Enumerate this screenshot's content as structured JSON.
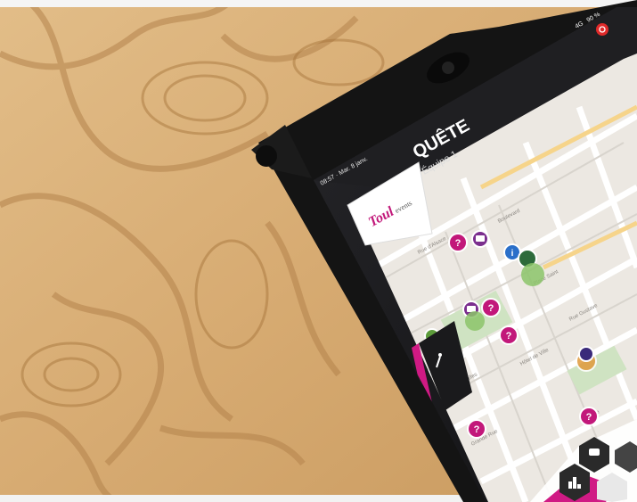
{
  "scene": {
    "description_tags": [
      "wooden-table",
      "tablet",
      "rugged-case",
      "map-app"
    ]
  },
  "tablet": {
    "status_bar": {
      "time_date": "08:57 · Mar. 8 janv.",
      "signal": "4G",
      "battery": "90 %"
    },
    "app": {
      "title": "QUÊTE",
      "subtitle": "Équipe 1",
      "logo_text": "Toul",
      "logo_subtext": "events"
    },
    "map": {
      "street_labels": [
        "Rue d'Alsace",
        "Boulevard",
        "Place Saint",
        "Rue des Halles",
        "Rue Gustave",
        "Hôtel de Ville",
        "Grande Rue",
        "Place"
      ]
    }
  },
  "colors": {
    "wood_base": "#d9b27c",
    "wood_grain": "#b07d44",
    "case": "#161616",
    "screen_bg": "#1e1e20",
    "map_bg": "#ece8e2",
    "accent_magenta": "#c2187a",
    "marker_purple": "#7b2f8e",
    "marker_green": "#5c9b3a",
    "marker_blue": "#2a6fc9",
    "marker_orange": "#e09a3c"
  },
  "icons": [
    "question-marker-icon",
    "info-marker-icon",
    "route-marker-icon",
    "chat-icon",
    "podium-icon",
    "power-icon",
    "signal-icon",
    "battery-icon"
  ]
}
